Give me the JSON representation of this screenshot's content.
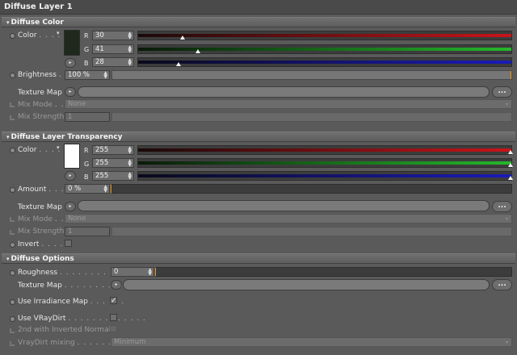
{
  "panel_title": "Diffuse Layer 1",
  "diffuse_color": {
    "header": "Diffuse Color",
    "color_label": "Color",
    "r_label": "R",
    "g_label": "G",
    "b_label": "B",
    "r": "30",
    "g": "41",
    "b": "28",
    "swatch": "#1e291c",
    "r_frac": 0.118,
    "g_frac": 0.161,
    "b_frac": 0.11,
    "brightness_label": "Brightness",
    "brightness": "100 %",
    "texture_map_label": "Texture Map",
    "mix_mode_label": "Mix Mode",
    "mix_mode_value": "None",
    "mix_strength_label": "Mix Strength",
    "mix_strength_value": "1",
    "ellipsis": "..."
  },
  "transparency": {
    "header": "Diffuse Layer Transparency",
    "color_label": "Color",
    "r_label": "R",
    "g_label": "G",
    "b_label": "B",
    "r": "255",
    "g": "255",
    "b": "255",
    "swatch": "#ffffff",
    "amount_label": "Amount",
    "amount": "0 %",
    "texture_map_label": "Texture Map",
    "mix_mode_label": "Mix Mode",
    "mix_mode_value": "None",
    "mix_strength_label": "Mix Strength",
    "mix_strength_value": "1",
    "invert_label": "Invert",
    "ellipsis": "..."
  },
  "options": {
    "header": "Diffuse Options",
    "roughness_label": "Roughness",
    "roughness": "0",
    "texture_map_label": "Texture Map",
    "use_irradiance_label": "Use Irradiance Map",
    "use_vraydirt_label": "Use VRayDirt",
    "inverted_normals_label": "2nd with Inverted Normals",
    "vraydirt_mixing_label": "VrayDirt mixing",
    "vraydirt_mixing_value": "Minimum",
    "ellipsis": "..."
  },
  "icons": {
    "check": "✓",
    "arrow_right": "▸",
    "arrow_down": "▾",
    "spin": "▲▼"
  },
  "colors": {
    "red_bar": "#c8141a",
    "green_bar": "#24b82a",
    "blue_bar": "#1a1ab8",
    "accent_orange": "#e89a16"
  }
}
